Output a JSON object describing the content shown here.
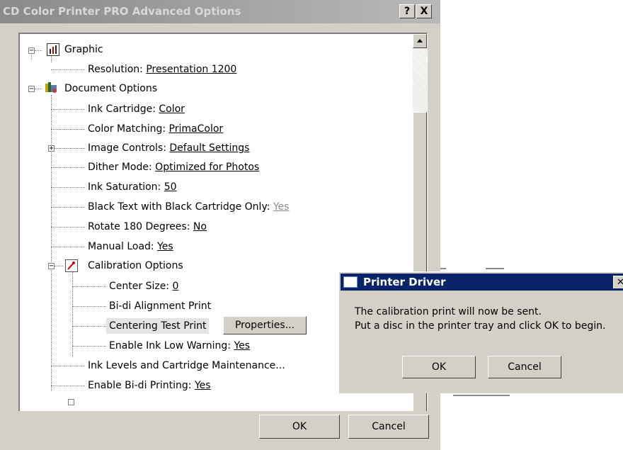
{
  "window": {
    "title": "CD Color Printer PRO Advanced Options",
    "help_button": "?",
    "close_button": "X"
  },
  "tree": {
    "graphic_label": "Graphic",
    "resolution_label": "Resolution: ",
    "resolution_value": "Presentation 1200",
    "document_options_label": "Document Options",
    "ink_cartridge_label": "Ink Cartridge: ",
    "ink_cartridge_value": "Color",
    "color_matching_label": "Color Matching: ",
    "color_matching_value": "PrimaColor",
    "image_controls_label": "Image Controls: ",
    "image_controls_value": "Default Settings",
    "dither_mode_label": "Dither Mode: ",
    "dither_mode_value": "Optimized for Photos",
    "ink_saturation_label": "Ink Saturation: ",
    "ink_saturation_value": "50",
    "black_text_label": "Black Text with Black Cartridge Only: ",
    "black_text_value": "Yes",
    "rotate_label": "Rotate 180 Degrees: ",
    "rotate_value": "No",
    "manual_load_label": "Manual Load: ",
    "manual_load_value": "Yes",
    "calibration_label": "Calibration Options",
    "center_size_label": "Center Size: ",
    "center_size_value": "0",
    "bidi_alignment_label": "Bi-di Alignment Print",
    "centering_test_label": "Centering Test Print",
    "properties_button": "Properties...",
    "ink_low_label": "Enable Ink Low Warning: ",
    "ink_low_value": "Yes",
    "ink_levels_label": "Ink Levels and Cartridge Maintenance...",
    "bidi_printing_label": "Enable Bi-di Printing: ",
    "bidi_printing_value": "Yes",
    "expand_symbol": "+",
    "collapse_symbol": "−"
  },
  "footer": {
    "ok_label": "OK",
    "cancel_label": "Cancel"
  },
  "popup": {
    "title": "Printer Driver",
    "close": "✕",
    "message_line1": "The calibration print will now be sent.",
    "message_line2": "Put a disc in the printer tray and click OK to begin.",
    "ok_label": "OK",
    "cancel_label": "Cancel"
  }
}
